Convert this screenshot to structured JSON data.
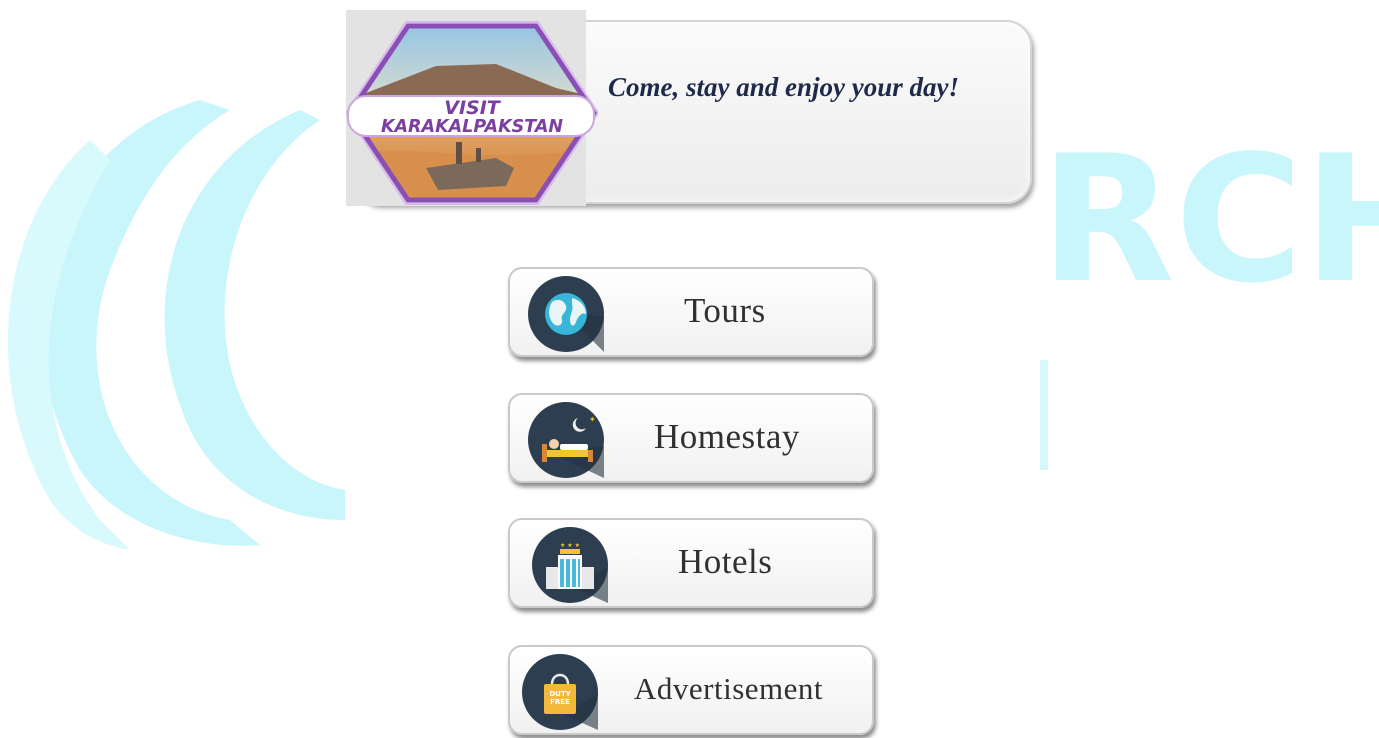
{
  "banner": {
    "logo_text_line1": "VISIT",
    "logo_text_line2": "KARAKALPAKSTAN",
    "tagline": "Come, stay and enjoy your day!"
  },
  "watermark": {
    "text": "RCH",
    "color": "#c9f6fb"
  },
  "menu": {
    "items": [
      {
        "label": "Tours",
        "icon": "globe-icon"
      },
      {
        "label": "Homestay",
        "icon": "bed-night-icon"
      },
      {
        "label": "Hotels",
        "icon": "hotel-building-icon"
      },
      {
        "label": "Advertisement",
        "icon": "duty-free-bag-icon"
      }
    ],
    "duty_free_line1": "DUTY",
    "duty_free_line2": "FREE"
  },
  "colors": {
    "icon_circle": "#2d3e50",
    "logo_purple": "#7a3fa0",
    "tagline": "#1d2a4a"
  }
}
